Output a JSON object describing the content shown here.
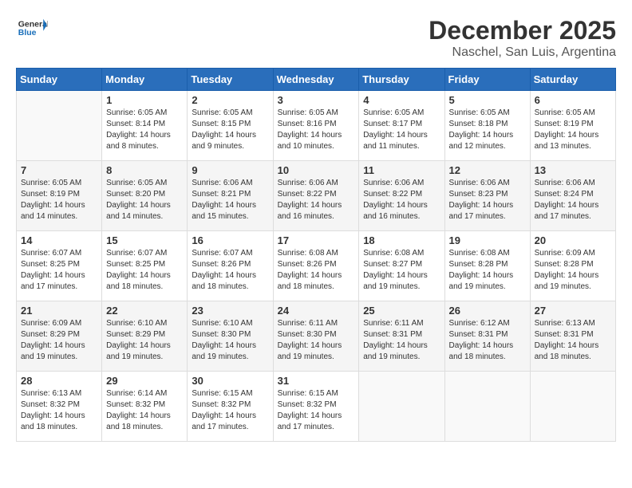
{
  "header": {
    "logo_general": "General",
    "logo_blue": "Blue",
    "month": "December 2025",
    "location": "Naschel, San Luis, Argentina"
  },
  "days_of_week": [
    "Sunday",
    "Monday",
    "Tuesday",
    "Wednesday",
    "Thursday",
    "Friday",
    "Saturday"
  ],
  "weeks": [
    [
      {
        "num": "",
        "info": ""
      },
      {
        "num": "1",
        "info": "Sunrise: 6:05 AM\nSunset: 8:14 PM\nDaylight: 14 hours\nand 8 minutes."
      },
      {
        "num": "2",
        "info": "Sunrise: 6:05 AM\nSunset: 8:15 PM\nDaylight: 14 hours\nand 9 minutes."
      },
      {
        "num": "3",
        "info": "Sunrise: 6:05 AM\nSunset: 8:16 PM\nDaylight: 14 hours\nand 10 minutes."
      },
      {
        "num": "4",
        "info": "Sunrise: 6:05 AM\nSunset: 8:17 PM\nDaylight: 14 hours\nand 11 minutes."
      },
      {
        "num": "5",
        "info": "Sunrise: 6:05 AM\nSunset: 8:18 PM\nDaylight: 14 hours\nand 12 minutes."
      },
      {
        "num": "6",
        "info": "Sunrise: 6:05 AM\nSunset: 8:19 PM\nDaylight: 14 hours\nand 13 minutes."
      }
    ],
    [
      {
        "num": "7",
        "info": "Sunrise: 6:05 AM\nSunset: 8:19 PM\nDaylight: 14 hours\nand 14 minutes."
      },
      {
        "num": "8",
        "info": "Sunrise: 6:05 AM\nSunset: 8:20 PM\nDaylight: 14 hours\nand 14 minutes."
      },
      {
        "num": "9",
        "info": "Sunrise: 6:06 AM\nSunset: 8:21 PM\nDaylight: 14 hours\nand 15 minutes."
      },
      {
        "num": "10",
        "info": "Sunrise: 6:06 AM\nSunset: 8:22 PM\nDaylight: 14 hours\nand 16 minutes."
      },
      {
        "num": "11",
        "info": "Sunrise: 6:06 AM\nSunset: 8:22 PM\nDaylight: 14 hours\nand 16 minutes."
      },
      {
        "num": "12",
        "info": "Sunrise: 6:06 AM\nSunset: 8:23 PM\nDaylight: 14 hours\nand 17 minutes."
      },
      {
        "num": "13",
        "info": "Sunrise: 6:06 AM\nSunset: 8:24 PM\nDaylight: 14 hours\nand 17 minutes."
      }
    ],
    [
      {
        "num": "14",
        "info": "Sunrise: 6:07 AM\nSunset: 8:25 PM\nDaylight: 14 hours\nand 17 minutes."
      },
      {
        "num": "15",
        "info": "Sunrise: 6:07 AM\nSunset: 8:25 PM\nDaylight: 14 hours\nand 18 minutes."
      },
      {
        "num": "16",
        "info": "Sunrise: 6:07 AM\nSunset: 8:26 PM\nDaylight: 14 hours\nand 18 minutes."
      },
      {
        "num": "17",
        "info": "Sunrise: 6:08 AM\nSunset: 8:26 PM\nDaylight: 14 hours\nand 18 minutes."
      },
      {
        "num": "18",
        "info": "Sunrise: 6:08 AM\nSunset: 8:27 PM\nDaylight: 14 hours\nand 19 minutes."
      },
      {
        "num": "19",
        "info": "Sunrise: 6:08 AM\nSunset: 8:28 PM\nDaylight: 14 hours\nand 19 minutes."
      },
      {
        "num": "20",
        "info": "Sunrise: 6:09 AM\nSunset: 8:28 PM\nDaylight: 14 hours\nand 19 minutes."
      }
    ],
    [
      {
        "num": "21",
        "info": "Sunrise: 6:09 AM\nSunset: 8:29 PM\nDaylight: 14 hours\nand 19 minutes."
      },
      {
        "num": "22",
        "info": "Sunrise: 6:10 AM\nSunset: 8:29 PM\nDaylight: 14 hours\nand 19 minutes."
      },
      {
        "num": "23",
        "info": "Sunrise: 6:10 AM\nSunset: 8:30 PM\nDaylight: 14 hours\nand 19 minutes."
      },
      {
        "num": "24",
        "info": "Sunrise: 6:11 AM\nSunset: 8:30 PM\nDaylight: 14 hours\nand 19 minutes."
      },
      {
        "num": "25",
        "info": "Sunrise: 6:11 AM\nSunset: 8:31 PM\nDaylight: 14 hours\nand 19 minutes."
      },
      {
        "num": "26",
        "info": "Sunrise: 6:12 AM\nSunset: 8:31 PM\nDaylight: 14 hours\nand 18 minutes."
      },
      {
        "num": "27",
        "info": "Sunrise: 6:13 AM\nSunset: 8:31 PM\nDaylight: 14 hours\nand 18 minutes."
      }
    ],
    [
      {
        "num": "28",
        "info": "Sunrise: 6:13 AM\nSunset: 8:32 PM\nDaylight: 14 hours\nand 18 minutes."
      },
      {
        "num": "29",
        "info": "Sunrise: 6:14 AM\nSunset: 8:32 PM\nDaylight: 14 hours\nand 18 minutes."
      },
      {
        "num": "30",
        "info": "Sunrise: 6:15 AM\nSunset: 8:32 PM\nDaylight: 14 hours\nand 17 minutes."
      },
      {
        "num": "31",
        "info": "Sunrise: 6:15 AM\nSunset: 8:32 PM\nDaylight: 14 hours\nand 17 minutes."
      },
      {
        "num": "",
        "info": ""
      },
      {
        "num": "",
        "info": ""
      },
      {
        "num": "",
        "info": ""
      }
    ]
  ]
}
